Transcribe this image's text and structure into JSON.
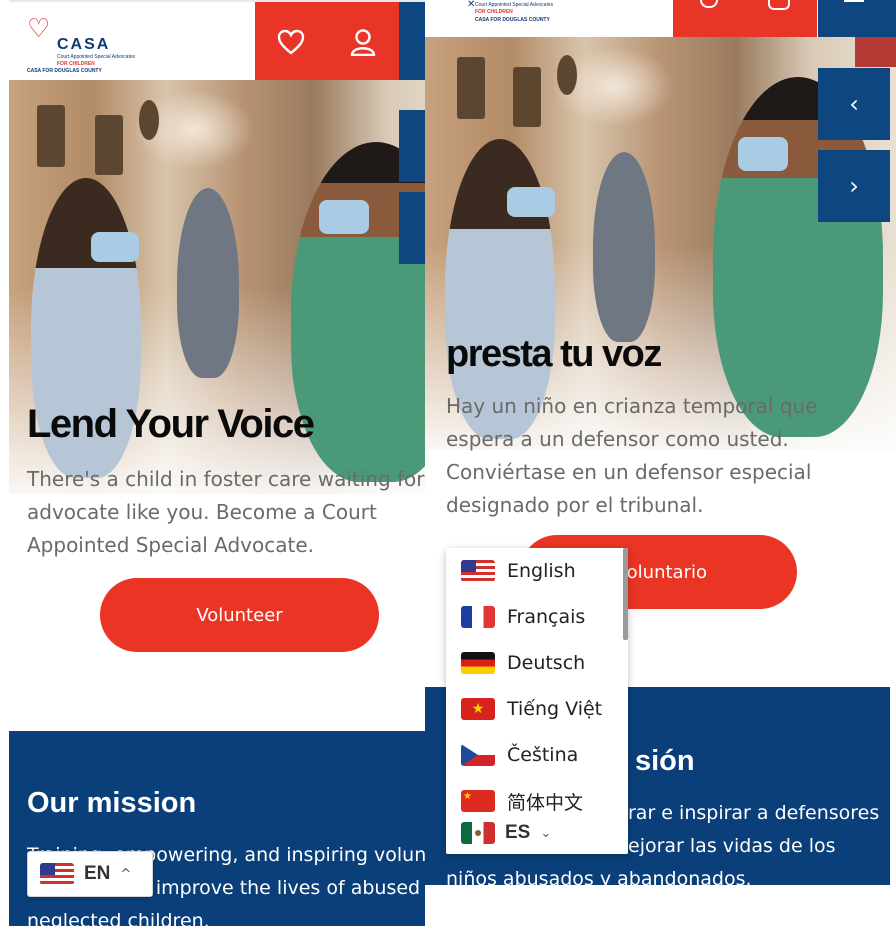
{
  "left": {
    "header": {
      "logo_word": "CASA",
      "logo_line1": "Court Appointed Special Advocates",
      "logo_line2": "FOR CHILDREN",
      "logo_line3": "CASA FOR DOUGLAS COUNTY"
    },
    "hero": {
      "title": "Lend Your Voice",
      "text": "There's a child in foster care waiting for an advocate like you. Become a Court Appointed Special Advocate.",
      "cta": "Volunteer"
    },
    "mission": {
      "title": "Our mission",
      "text": "Training, empowering, and inspiring volunteer advocates to improve the lives of abused and neglected children."
    },
    "language_toggle": {
      "code": "EN",
      "caret": "^",
      "flag": "us"
    }
  },
  "right": {
    "header": {
      "logo_line1": "Court Appointed Special Advocates",
      "logo_line2": "FOR CHILDREN",
      "logo_line3": "CASA FOR DOUGLAS COUNTY"
    },
    "slider": {
      "prev": "‹",
      "next": "›"
    },
    "hero": {
      "title": "presta tu voz",
      "text": "Hay un niño en crianza temporal que espera a un defensor como usted. Conviértase en un defensor especial designado por el tribunal.",
      "cta": "Voluntario",
      "cta_visible": "oluntario"
    },
    "mission": {
      "title": "Nuestra misión",
      "title_visible": "sión",
      "text_line1_visible": "rar e inspirar a defensores",
      "text_line2_visible": "ejorar las vidas de los",
      "text_line3": "niños abusados y abandonados."
    },
    "language_menu": {
      "items": [
        {
          "label": "English",
          "flag": "us"
        },
        {
          "label": "Français",
          "flag": "fr"
        },
        {
          "label": "Deutsch",
          "flag": "de"
        },
        {
          "label": "Tiếng Việt",
          "flag": "vn"
        },
        {
          "label": "Čeština",
          "flag": "cz"
        },
        {
          "label": "简体中文",
          "flag": "cn"
        }
      ],
      "current_code": "ES",
      "current_flag": "mx",
      "caret": "⌄"
    }
  },
  "colors": {
    "red": "#e83528",
    "blue": "#0e4680",
    "mission_blue": "#0a3f7a",
    "text_gray": "#6a6a6a"
  }
}
